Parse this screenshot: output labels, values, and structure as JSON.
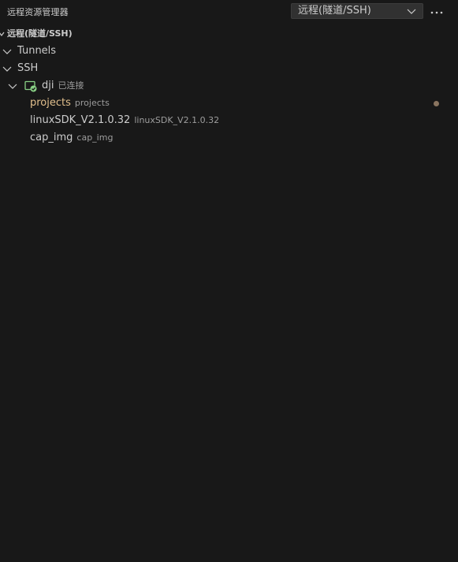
{
  "panel": {
    "title": "远程资源管理器",
    "selector_value": "远程(隧道/SSH)",
    "more_icon": "ellipsis-icon"
  },
  "section": {
    "label": "远程(隧道/SSH)"
  },
  "tree": {
    "tunnels": "Tunnels",
    "ssh": "SSH",
    "host": {
      "name": "dji",
      "status": "已连接",
      "icon": "remote-connected-icon",
      "status_color": "#89d185"
    },
    "folders": [
      {
        "name": "projects",
        "desc": "projects",
        "modified": true,
        "color": "#e2c08d"
      },
      {
        "name": "linuxSDK_V2.1.0.32",
        "desc": "linuxSDK_V2.1.0.32",
        "modified": false
      },
      {
        "name": "cap_img",
        "desc": "cap_img",
        "modified": false
      }
    ]
  },
  "colors": {
    "background": "#181818",
    "text": "#cccccc",
    "description": "#9d9d9d"
  }
}
